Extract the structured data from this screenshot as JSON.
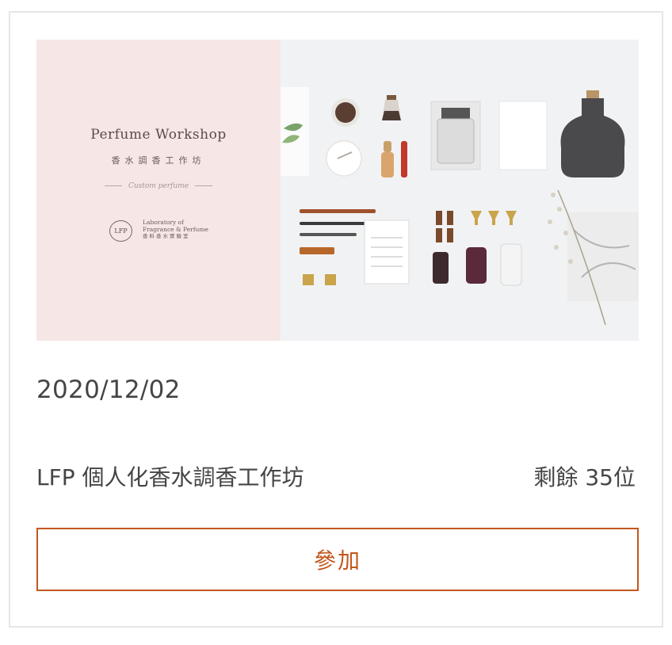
{
  "event": {
    "banner": {
      "title": "Perfume Workshop",
      "subtitle": "香水調香工作坊",
      "tagline": "Custom perfume",
      "logo_text": "LFP",
      "lab_line1": "Laboratory of",
      "lab_line2": "Fragrance & Perfume",
      "lab_line3": "香料香水實驗室",
      "left_bg": "#f6e6e6"
    },
    "date": "2020/12/02",
    "name": "LFP 個人化香水調香工作坊",
    "remaining": "剩餘 35位",
    "join_label": "參加",
    "accent_color": "#c2571d"
  }
}
